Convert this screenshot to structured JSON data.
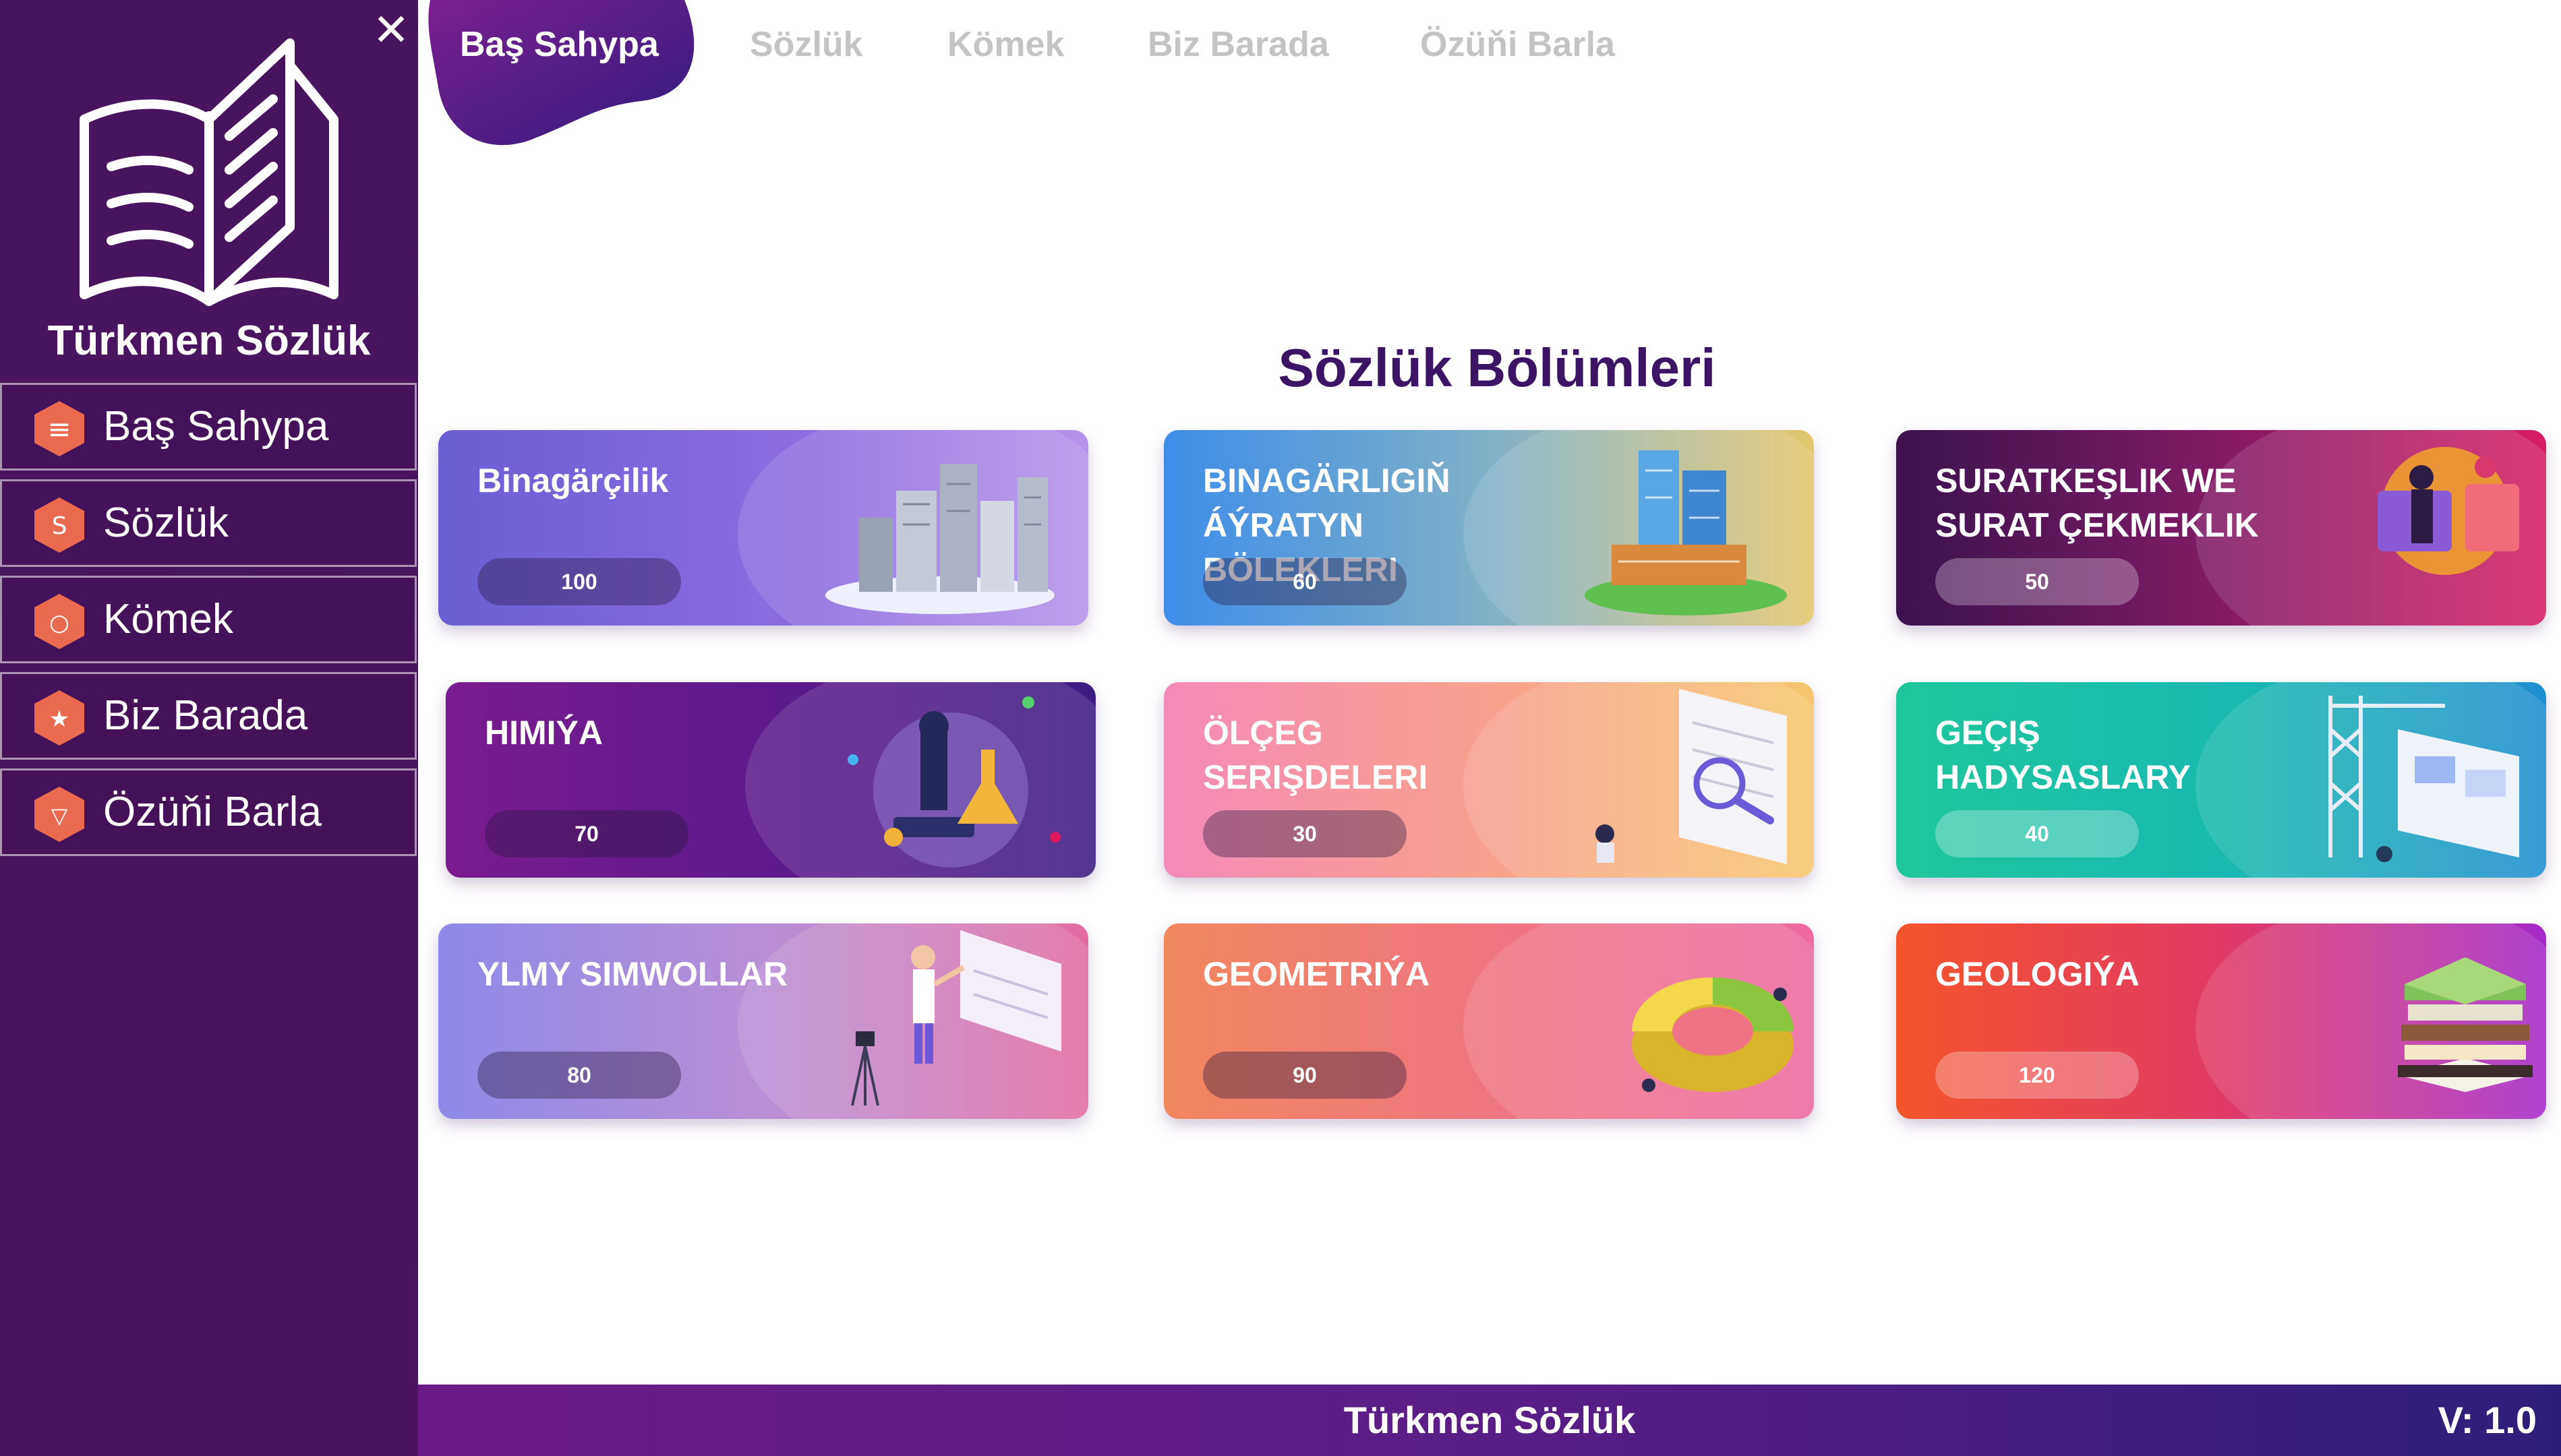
{
  "app": {
    "name": "Türkmen Sözlük",
    "close_label": "✕"
  },
  "sidebar": {
    "items": [
      {
        "label": "Baş Sahypa",
        "icon": "menu-lines-icon",
        "glyph": "≡"
      },
      {
        "label": "Sözlük",
        "icon": "dictionary-s-icon",
        "glyph": "S"
      },
      {
        "label": "Kömek",
        "icon": "help-circle-icon",
        "glyph": "○"
      },
      {
        "label": "Biz Barada",
        "icon": "star-icon",
        "glyph": "★"
      },
      {
        "label": "Özüňi Barla",
        "icon": "test-check-icon",
        "glyph": "▽"
      }
    ]
  },
  "tabs": [
    {
      "label": "Baş Sahypa",
      "active": true
    },
    {
      "label": "Sözlük",
      "active": false
    },
    {
      "label": "Kömek",
      "active": false
    },
    {
      "label": "Biz Barada",
      "active": false
    },
    {
      "label": "Özüňi Barla",
      "active": false
    }
  ],
  "main": {
    "section_title": "Sözlük Bölümleri",
    "cards": [
      {
        "title": "Binagärçilik",
        "count": "100",
        "illustration": "city-buildings-illustration"
      },
      {
        "title": "BINAGÄRLIGIŇ ÁÝRATYN BÖLEKLERI",
        "count": "60",
        "illustration": "office-towers-illustration"
      },
      {
        "title": "SURATKEŞLIK WE SURAT ÇEKMEKLIK",
        "count": "50",
        "illustration": "artists-illustration"
      },
      {
        "title": "HIMIÝA",
        "count": "70",
        "illustration": "microscope-flask-illustration"
      },
      {
        "title": "ÖLÇEG SERIŞDELERI",
        "count": "30",
        "illustration": "magnifier-document-illustration"
      },
      {
        "title": "GEÇIŞ HADYSASLARY",
        "count": "40",
        "illustration": "crane-screen-illustration"
      },
      {
        "title": "YLMY SIMWOLLAR",
        "count": "80",
        "illustration": "lesson-board-illustration"
      },
      {
        "title": "GEOMETRIÝA",
        "count": "90",
        "illustration": "donut-chart-illustration"
      },
      {
        "title": "GEOLOGIÝA",
        "count": "120",
        "illustration": "book-stack-illustration"
      }
    ]
  },
  "footer": {
    "title": "Türkmen Sözlük",
    "version": "V: 1.0"
  },
  "colors": {
    "sidebar_bg": "#4a1460",
    "title_color": "#3b1466",
    "nav_icon": "#e96a4f"
  }
}
